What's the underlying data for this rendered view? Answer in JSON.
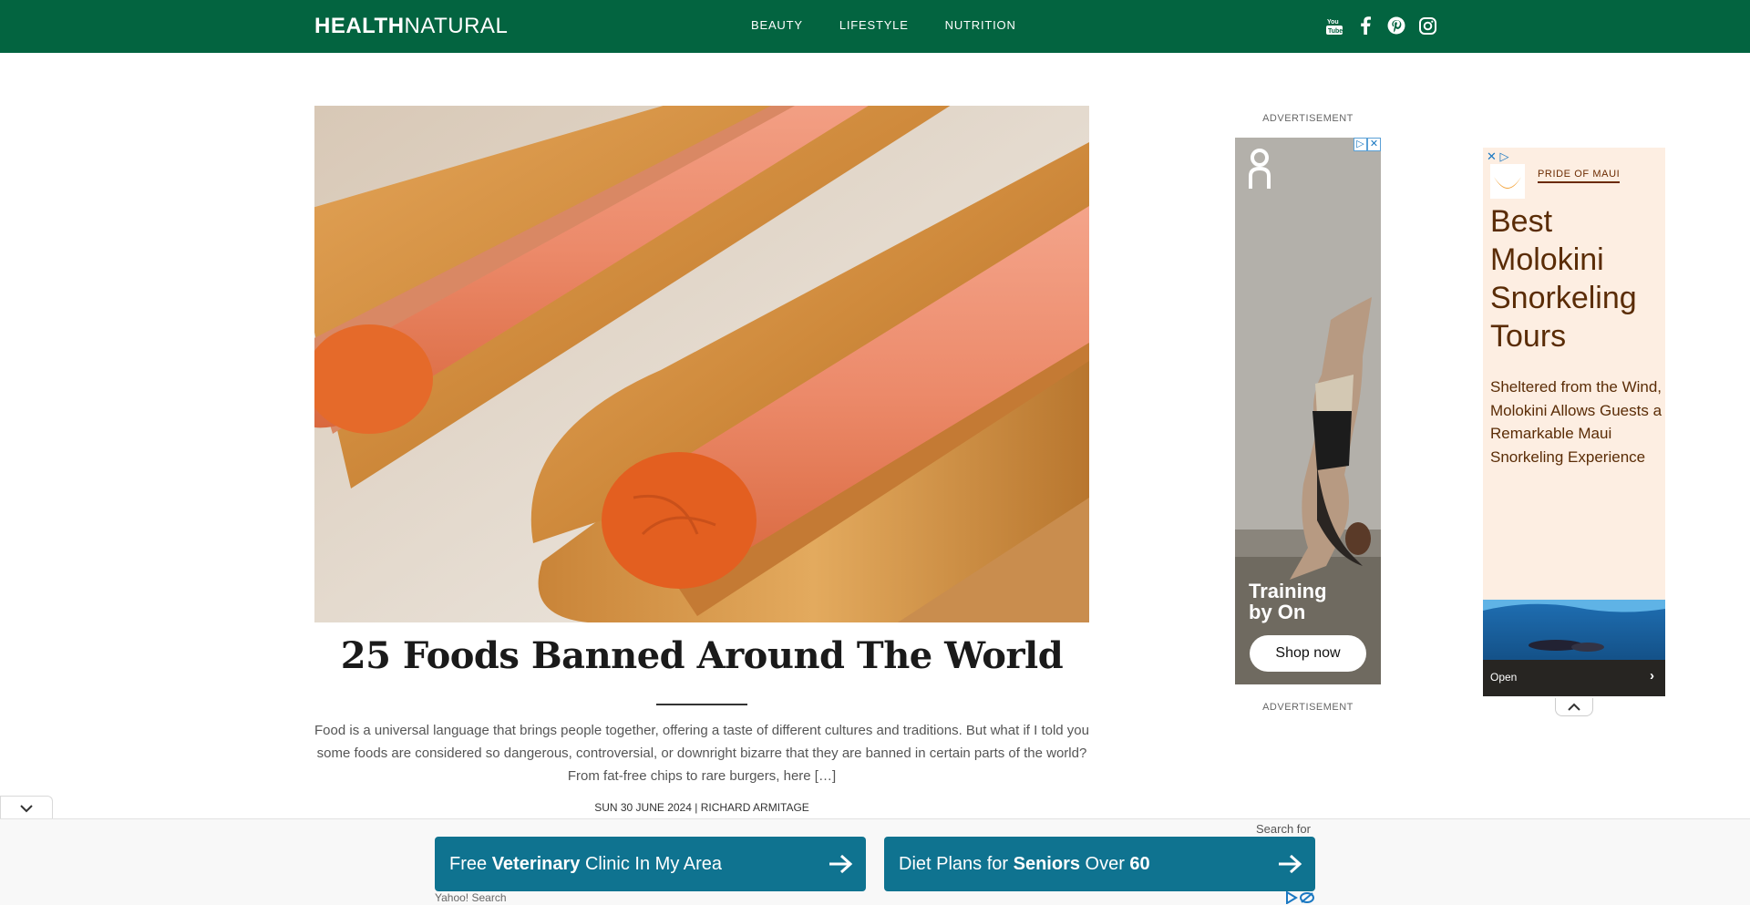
{
  "header": {
    "logo_bold": "HEALTH",
    "logo_thin": "NATURAL",
    "nav": [
      "BEAUTY",
      "LIFESTYLE",
      "NUTRITION"
    ],
    "social_icons": [
      "youtube-icon",
      "facebook-icon",
      "pinterest-icon",
      "instagram-icon"
    ],
    "background_color": "#036440"
  },
  "article": {
    "title": "25 Foods Banned Around The World",
    "excerpt": "Food is a universal language that brings people together, offering a taste of different cultures and traditions. But what if I told you some foods are considered so dangerous, controversial, or downright bizarre that they are banned in certain parts of the world? From fat-free chips to rare burgers, here […]",
    "meta": "SUN 30 JUNE 2024 | RICHARD ARMITAGE"
  },
  "side_ad": {
    "label_top": "ADVERTISEMENT",
    "label_bottom": "ADVERTISEMENT",
    "tagline": "Training by On",
    "cta": "Shop now"
  },
  "maui_ad": {
    "brand": "PRIDE OF MAUI",
    "headline": "Best Molokini Snorkeling Tours",
    "body": "Sheltered from the Wind, Molokini Allows Guests a Remarkable Maui Snorkeling Experience",
    "open_label": "Open"
  },
  "bottom_bar": {
    "search_for": "Search for",
    "buttons": [
      {
        "pre": "Free ",
        "bold": "Veterinary",
        "post": " Clinic In My Area"
      },
      {
        "pre": "Diet Plans for ",
        "bold": "Seniors",
        "post": " Over ",
        "bold2": "60"
      }
    ],
    "source": "Yahoo! Search",
    "button_color": "#0f7390"
  }
}
